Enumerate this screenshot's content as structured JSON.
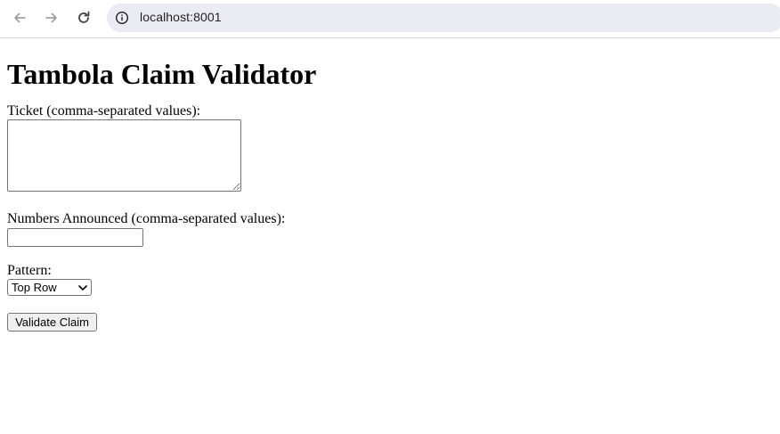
{
  "browser": {
    "url": "localhost:8001",
    "icons": {
      "back": "arrow-left-icon",
      "forward": "arrow-right-icon",
      "reload": "reload-icon",
      "site_info": "info-icon"
    }
  },
  "page": {
    "title": "Tambola Claim Validator",
    "ticket_label": "Ticket (comma-separated values):",
    "ticket_value": "",
    "numbers_label": "Numbers Announced (comma-separated values):",
    "numbers_value": "",
    "pattern_label": "Pattern:",
    "pattern_selected": "Top Row",
    "submit_label": "Validate Claim"
  }
}
